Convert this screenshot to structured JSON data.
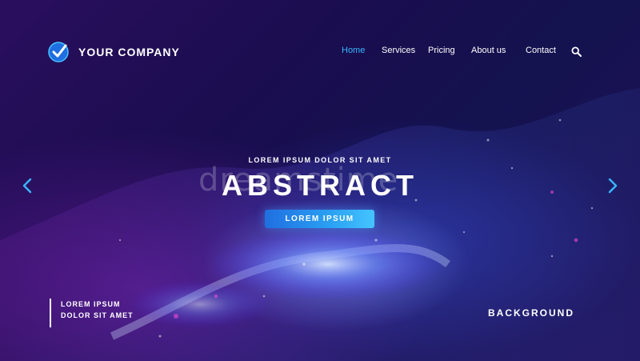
{
  "brand": {
    "name": "YOUR COMPANY",
    "logo_icon": "checkmark-badge-icon"
  },
  "nav": {
    "items": [
      {
        "label": "Home",
        "active": true
      },
      {
        "label": "Services",
        "active": false
      },
      {
        "label": "Pricing",
        "active": false
      },
      {
        "label": "About us",
        "active": false
      },
      {
        "label": "Contact",
        "active": false
      }
    ],
    "search_icon": "search-icon"
  },
  "hero": {
    "subtitle": "LOREM IPSUM DOLOR SIT AMET",
    "headline": "ABSTRACT",
    "cta_label": "LOREM IPSUM",
    "watermark": "dreamstime"
  },
  "bottom": {
    "left_line1": "LOREM IPSUM",
    "left_line2": "DOLOR SIT AMET",
    "right_label": "BACKGROUND"
  },
  "carousel": {
    "prev_icon": "chevron-left-icon",
    "next_icon": "chevron-right-icon"
  },
  "colors": {
    "accent": "#39b6ff",
    "cta_start": "#1f6fe0",
    "cta_end": "#45c4ff",
    "background": "#1a0d4f"
  }
}
